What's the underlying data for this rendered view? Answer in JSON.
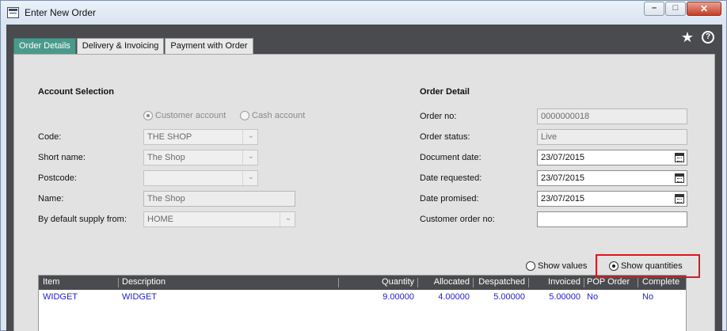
{
  "window": {
    "title": "Enter New Order"
  },
  "toolbar": {
    "favourite_icon": "star-icon",
    "help_icon": "help-icon"
  },
  "tabs": [
    {
      "label": "Order Details",
      "active": true
    },
    {
      "label": "Delivery & Invoicing",
      "active": false
    },
    {
      "label": "Payment with Order",
      "active": false
    }
  ],
  "account": {
    "title": "Account Selection",
    "radio_customer": "Customer account",
    "radio_cash": "Cash account",
    "selected": "Customer account",
    "code_label": "Code:",
    "code_value": "THE SHOP",
    "short_name_label": "Short name:",
    "short_name_value": "The Shop",
    "postcode_label": "Postcode:",
    "postcode_value": "",
    "name_label": "Name:",
    "name_value": "The Shop",
    "supply_label": "By default supply from:",
    "supply_value": "HOME"
  },
  "order": {
    "title": "Order Detail",
    "order_no_label": "Order no:",
    "order_no_value": "0000000018",
    "status_label": "Order status:",
    "status_value": "Live",
    "doc_date_label": "Document date:",
    "doc_date_value": "23/07/2015",
    "date_requested_label": "Date requested:",
    "date_requested_value": "23/07/2015",
    "date_promised_label": "Date promised:",
    "date_promised_value": "23/07/2015",
    "customer_order_label": "Customer order no:",
    "customer_order_value": ""
  },
  "view_toggle": {
    "show_values": "Show values",
    "show_quantities": "Show quantities",
    "selected": "Show quantities"
  },
  "grid": {
    "columns": [
      "Item",
      "Description",
      "Quantity",
      "Allocated",
      "Despatched",
      "Invoiced",
      "POP Order",
      "Complete"
    ],
    "rows": [
      {
        "item": "WIDGET",
        "description": "WIDGET",
        "quantity": "9.00000",
        "allocated": "4.00000",
        "despatched": "5.00000",
        "invoiced": "5.00000",
        "pop_order": "No",
        "complete": "No"
      }
    ]
  },
  "colors": {
    "highlight": "#e0161b",
    "active_tab": "#4a9a8c",
    "link_text": "#1f1fc8",
    "dark_header": "#4a4b4e"
  }
}
